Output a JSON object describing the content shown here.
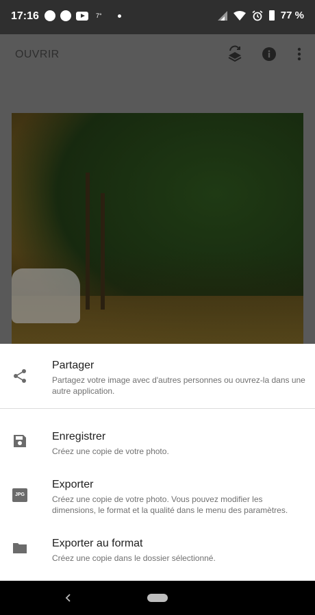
{
  "status_bar": {
    "time": "17:16",
    "temperature": "7°",
    "battery": "77 %"
  },
  "app_bar": {
    "open_label": "OUVRIR",
    "icons": [
      "layers-swap-icon",
      "info-icon",
      "more-vert-icon"
    ]
  },
  "sheet": {
    "items": [
      {
        "icon": "share-icon",
        "title": "Partager",
        "description": "Partagez votre image avec d'autres personnes ou ouvrez-la dans une autre application."
      },
      {
        "icon": "save-icon",
        "title": "Enregistrer",
        "description": "Créez une copie de votre photo."
      },
      {
        "icon": "jpg-icon",
        "icon_text": "JPG",
        "title": "Exporter",
        "description": "Créez une copie de votre photo. Vous pouvez modifier les dimensions, le format et la qualité dans le menu des paramètres."
      },
      {
        "icon": "folder-icon",
        "title": "Exporter au format",
        "description": "Créez une copie dans le dossier sélectionné."
      }
    ]
  },
  "colors": {
    "scrim": "#595959",
    "sheet_bg": "#ffffff",
    "icon_gray": "#6b6b6b",
    "navbar": "#000000"
  }
}
